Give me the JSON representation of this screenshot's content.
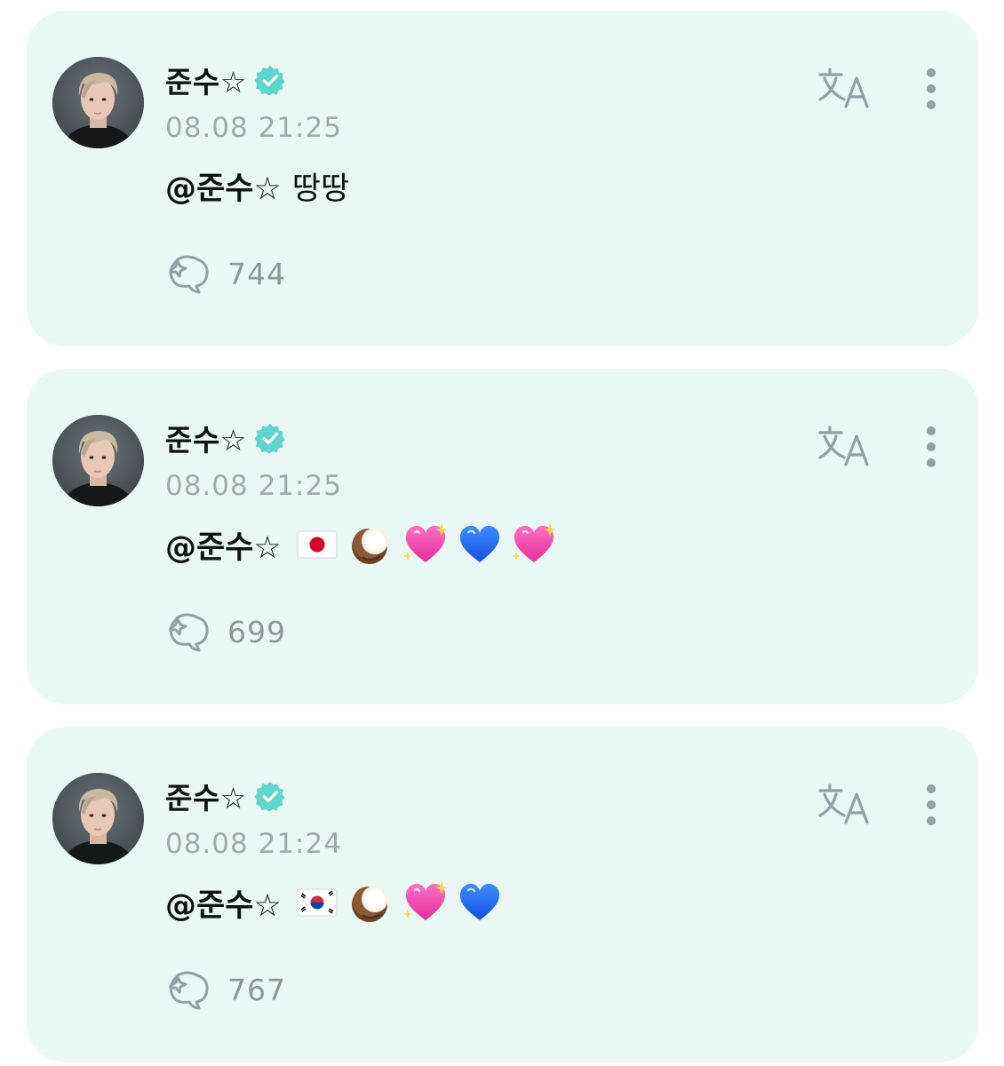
{
  "posts": [
    {
      "author": "준수☆",
      "timestamp": "08.08 21:25",
      "mention": "@준수☆",
      "text": "땅땅",
      "emojis": [],
      "reply_count": "744"
    },
    {
      "author": "준수☆",
      "timestamp": "08.08 21:25",
      "mention": "@준수☆",
      "text": "",
      "emojis": [
        "flag-japan-icon",
        "coconut-icon",
        "sparkling-heart-icon",
        "blue-heart-icon",
        "sparkling-heart-icon"
      ],
      "reply_count": "699"
    },
    {
      "author": "준수☆",
      "timestamp": "08.08 21:24",
      "mention": "@준수☆",
      "text": "",
      "emojis": [
        "flag-korea-icon",
        "coconut-icon",
        "sparkling-heart-icon",
        "blue-heart-icon"
      ],
      "reply_count": "767"
    }
  ],
  "colors": {
    "card_bg": "#e9f8f5",
    "verified": "#5ed6c9",
    "muted_text": "#a2a9ae",
    "icon_gray": "#8fa0a6"
  },
  "icons": {
    "verified": "verified-badge-icon",
    "translate": "translate-icon",
    "more": "more-vertical-icon",
    "reply": "reply-bubble-icon"
  }
}
